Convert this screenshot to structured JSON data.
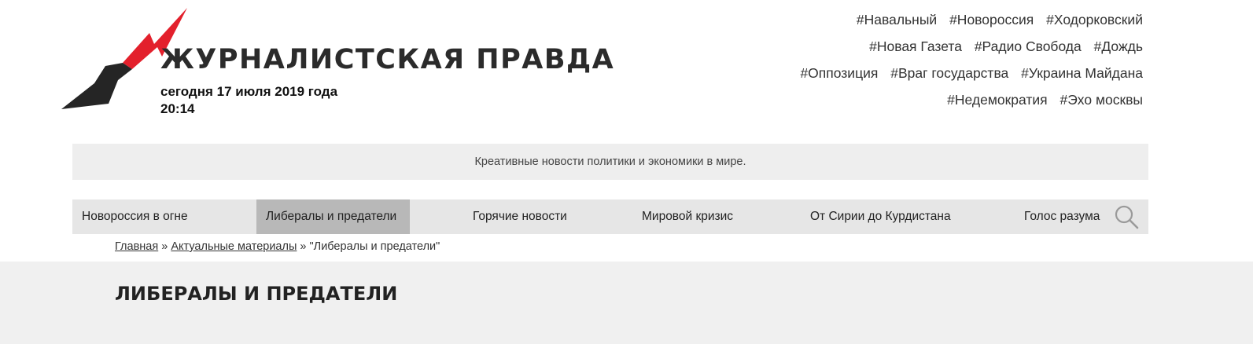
{
  "header": {
    "site_title": "ЖУРНАЛИСТСКАЯ ПРАВДА",
    "date": "сегодня 17 июля 2019 года",
    "time": "20:14",
    "logo_icon": "lightning-bolt-icon",
    "colors": {
      "logo_red": "#e3202c",
      "logo_dark": "#252525"
    }
  },
  "tags": [
    "#Навальный",
    "#Новороссия",
    "#Ходорковский",
    "#Новая Газета",
    "#Радио Свобода",
    "#Дождь",
    "#Оппозиция",
    "#Враг государства",
    "#Украина Майдана",
    "#Недемократия",
    "#Эхо москвы"
  ],
  "slogan": "Креативные новости политики и экономики в мире.",
  "nav": {
    "items": [
      {
        "label": "Новороссия в огне"
      },
      {
        "label": "Либералы и предатели",
        "active": true
      },
      {
        "label": "Горячие новости"
      },
      {
        "label": "Мировой кризис"
      },
      {
        "label": "От Сирии до Курдистана"
      },
      {
        "label": "Голос разума"
      }
    ],
    "search_icon": "search-icon",
    "colors": {
      "bar": "#e6e6e6",
      "active": "#b8b8b8"
    }
  },
  "breadcrumb": {
    "home": "Главная",
    "sep1": "»",
    "section": "Актуальные материалы",
    "sep2": "»",
    "current": "\"Либералы и предатели\""
  },
  "page": {
    "title": "ЛИБЕРАЛЫ И ПРЕДАТЕЛИ"
  }
}
